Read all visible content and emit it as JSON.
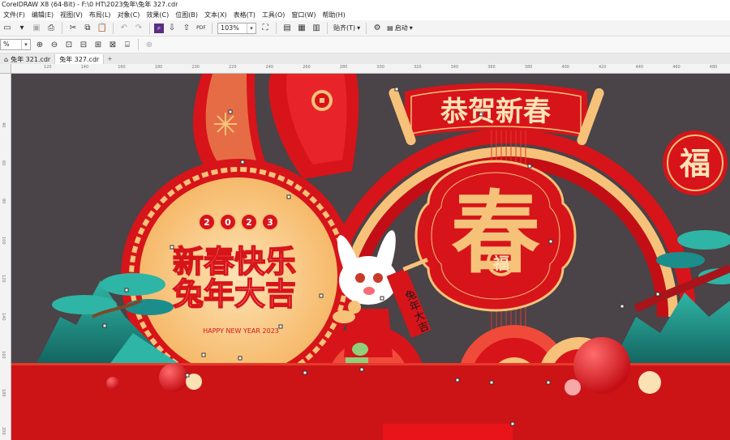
{
  "app": {
    "title": "CorelDRAW X8 (64-Bit) - F:\\0 HT\\2023兔年\\兔年 327.cdr"
  },
  "menu": [
    "文件(F)",
    "编辑(E)",
    "视图(V)",
    "布局(L)",
    "对象(C)",
    "效果(C)",
    "位图(B)",
    "文本(X)",
    "表格(T)",
    "工具(O)",
    "窗口(W)",
    "帮助(H)"
  ],
  "toolbar": {
    "zoom_value": "103%",
    "snap_label": "贴齐(T)",
    "launch_label": "启动"
  },
  "toolbar2": {
    "zoom_value": "%"
  },
  "tabs": [
    {
      "label": "兔年 321.cdr"
    },
    {
      "label": "兔年 327.cdr"
    }
  ],
  "ruler_h": [
    "120",
    "140",
    "160",
    "180",
    "200",
    "220",
    "240",
    "260",
    "280",
    "300",
    "320",
    "340",
    "360",
    "380",
    "400",
    "420",
    "440",
    "460",
    "480"
  ],
  "ruler_v": [
    "40",
    "60",
    "80",
    "100",
    "120",
    "140",
    "160",
    "180",
    "200"
  ],
  "artwork": {
    "banner_title": "恭贺新春",
    "big_char": "春",
    "fu": "福",
    "year": [
      "2",
      "0",
      "2",
      "3"
    ],
    "slogan1": "新春快乐",
    "slogan2": "兔年大吉",
    "english": "HAPPY NEW YEAR 2023",
    "scroll_text": "兔年大吉"
  },
  "colors": {
    "red": "#d7141a",
    "gold": "#f6c27a",
    "bg": "#4a4347",
    "teal": "#1b8e8c"
  }
}
